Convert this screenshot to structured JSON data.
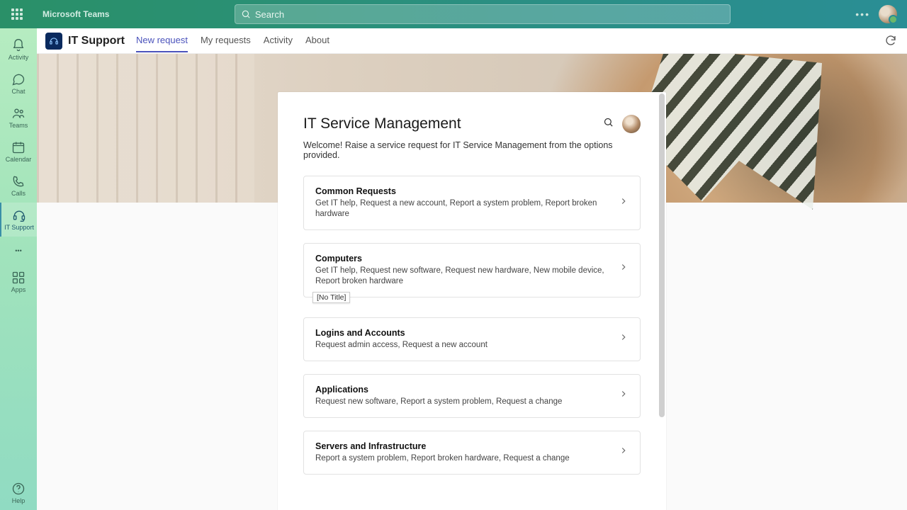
{
  "titlebar": {
    "app_title": "Microsoft Teams",
    "search_placeholder": "Search"
  },
  "rail": {
    "items": [
      {
        "key": "activity",
        "label": "Activity"
      },
      {
        "key": "chat",
        "label": "Chat"
      },
      {
        "key": "teams",
        "label": "Teams"
      },
      {
        "key": "calendar",
        "label": "Calendar"
      },
      {
        "key": "calls",
        "label": "Calls"
      },
      {
        "key": "itsupport",
        "label": "IT Support"
      }
    ],
    "apps_label": "Apps",
    "help_label": "Help"
  },
  "page": {
    "app_name": "IT Support",
    "tabs": [
      {
        "key": "new",
        "label": "New request",
        "active": true
      },
      {
        "key": "my",
        "label": "My requests",
        "active": false
      },
      {
        "key": "activity",
        "label": "Activity",
        "active": false
      },
      {
        "key": "about",
        "label": "About",
        "active": false
      }
    ]
  },
  "panel": {
    "title": "IT Service Management",
    "subtitle": "Welcome! Raise a service request for IT Service Management from the options provided.",
    "tooltip": "[No Title]",
    "cards": [
      {
        "title": "Common Requests",
        "desc": "Get IT help, Request a new account, Report a system problem, Report broken hardware"
      },
      {
        "title": "Computers",
        "desc": "Get IT help, Request new software, Request new hardware, New mobile device, Report broken hardware"
      },
      {
        "title": "Logins and Accounts",
        "desc": "Request admin access, Request a new account"
      },
      {
        "title": "Applications",
        "desc": "Request new software, Report a system problem, Request a change"
      },
      {
        "title": "Servers and Infrastructure",
        "desc": "Report a system problem, Report broken hardware, Request a change"
      }
    ]
  }
}
